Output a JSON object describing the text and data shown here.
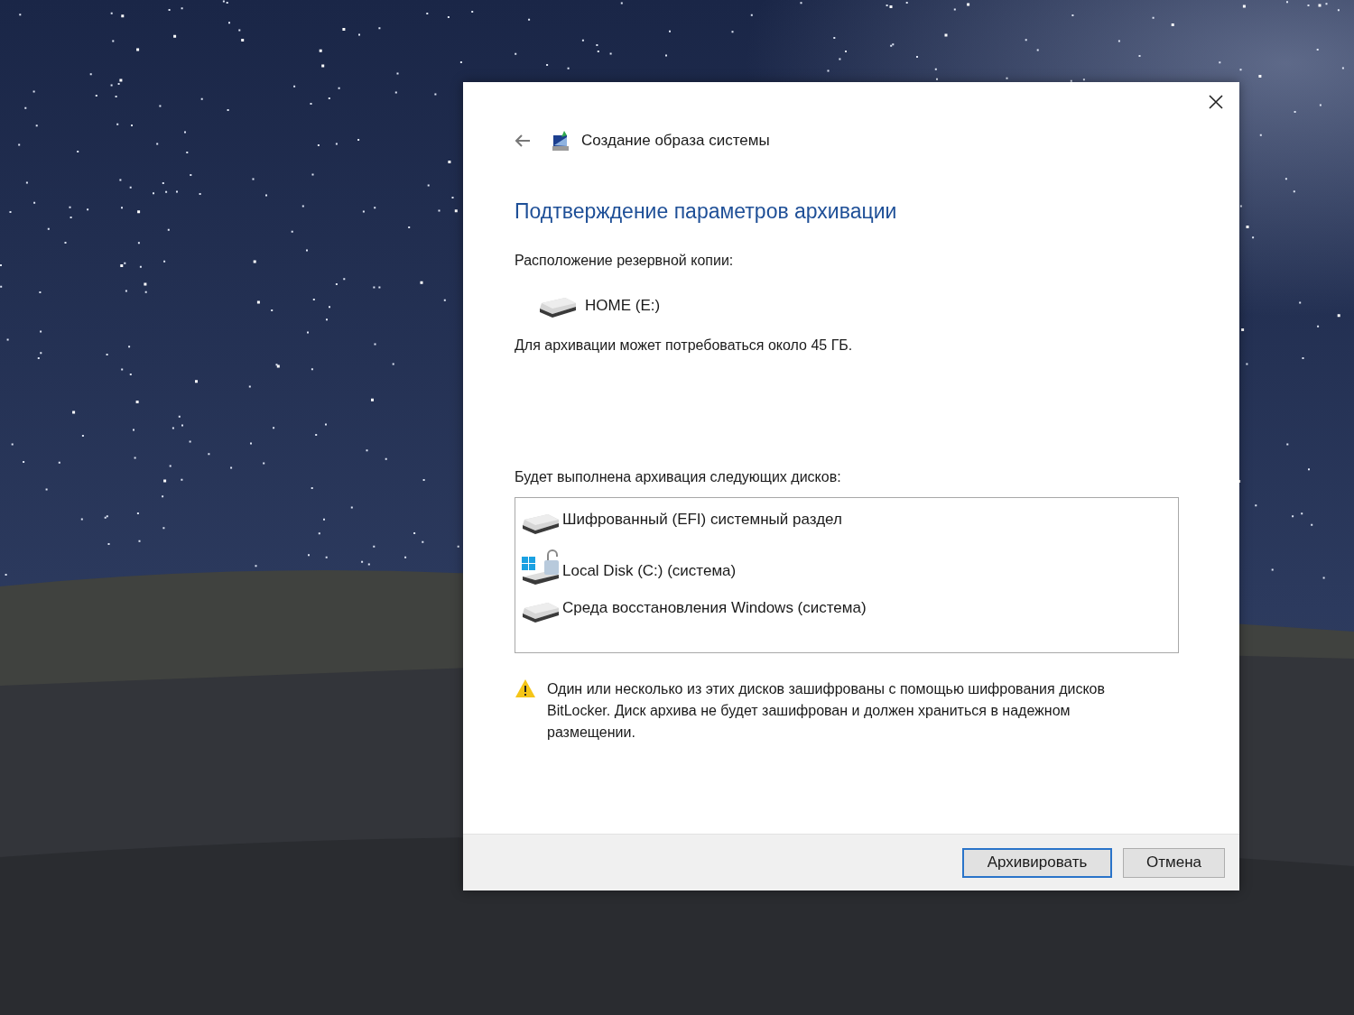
{
  "dialog": {
    "title": "Создание образа системы",
    "heading": "Подтверждение параметров архивации",
    "location_label": "Расположение резервной копии:",
    "location": "HOME (E:)",
    "size_note": "Для архивации может потребоваться около 45 ГБ.",
    "disks_label": "Будет выполнена архивация следующих дисков:",
    "disks": [
      {
        "kind": "drive",
        "name": "Шифрованный (EFI) системный раздел"
      },
      {
        "kind": "system",
        "name": "Local Disk (C:) (система)"
      },
      {
        "kind": "drive",
        "name": "Среда восстановления Windows (система)"
      }
    ],
    "warning": "Один или несколько из этих дисков зашифрованы с помощью шифрования дисков BitLocker. Диск архива не будет зашифрован и должен храниться в надежном размещении.",
    "buttons": [
      {
        "label": "Архивировать",
        "default": true
      },
      {
        "label": "Отмена",
        "default": false
      }
    ]
  }
}
